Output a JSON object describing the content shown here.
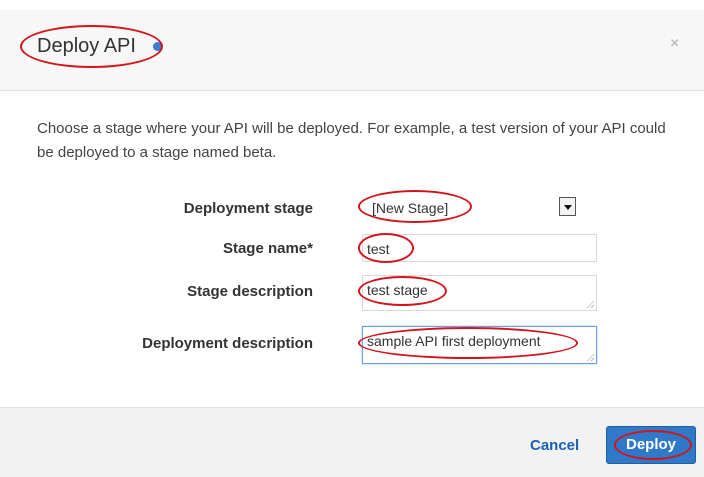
{
  "dialog": {
    "title": "Deploy API",
    "close_glyph": "×",
    "intro": "Choose a stage where your API will be deployed. For example, a test version of your API could be deployed to a stage named beta."
  },
  "form": {
    "stage_label": "Deployment stage",
    "stage_value": "[New Stage]",
    "name_label": "Stage name*",
    "name_value": "test",
    "stage_desc_label": "Stage description",
    "stage_desc_value": "test stage",
    "deploy_desc_label": "Deployment description",
    "deploy_desc_value": "sample API first deployment"
  },
  "footer": {
    "cancel_label": "Cancel",
    "deploy_label": "Deploy"
  },
  "colors": {
    "primary_button": "#2f79c8",
    "link": "#1a5fb4",
    "annotation": "#d2151b"
  }
}
